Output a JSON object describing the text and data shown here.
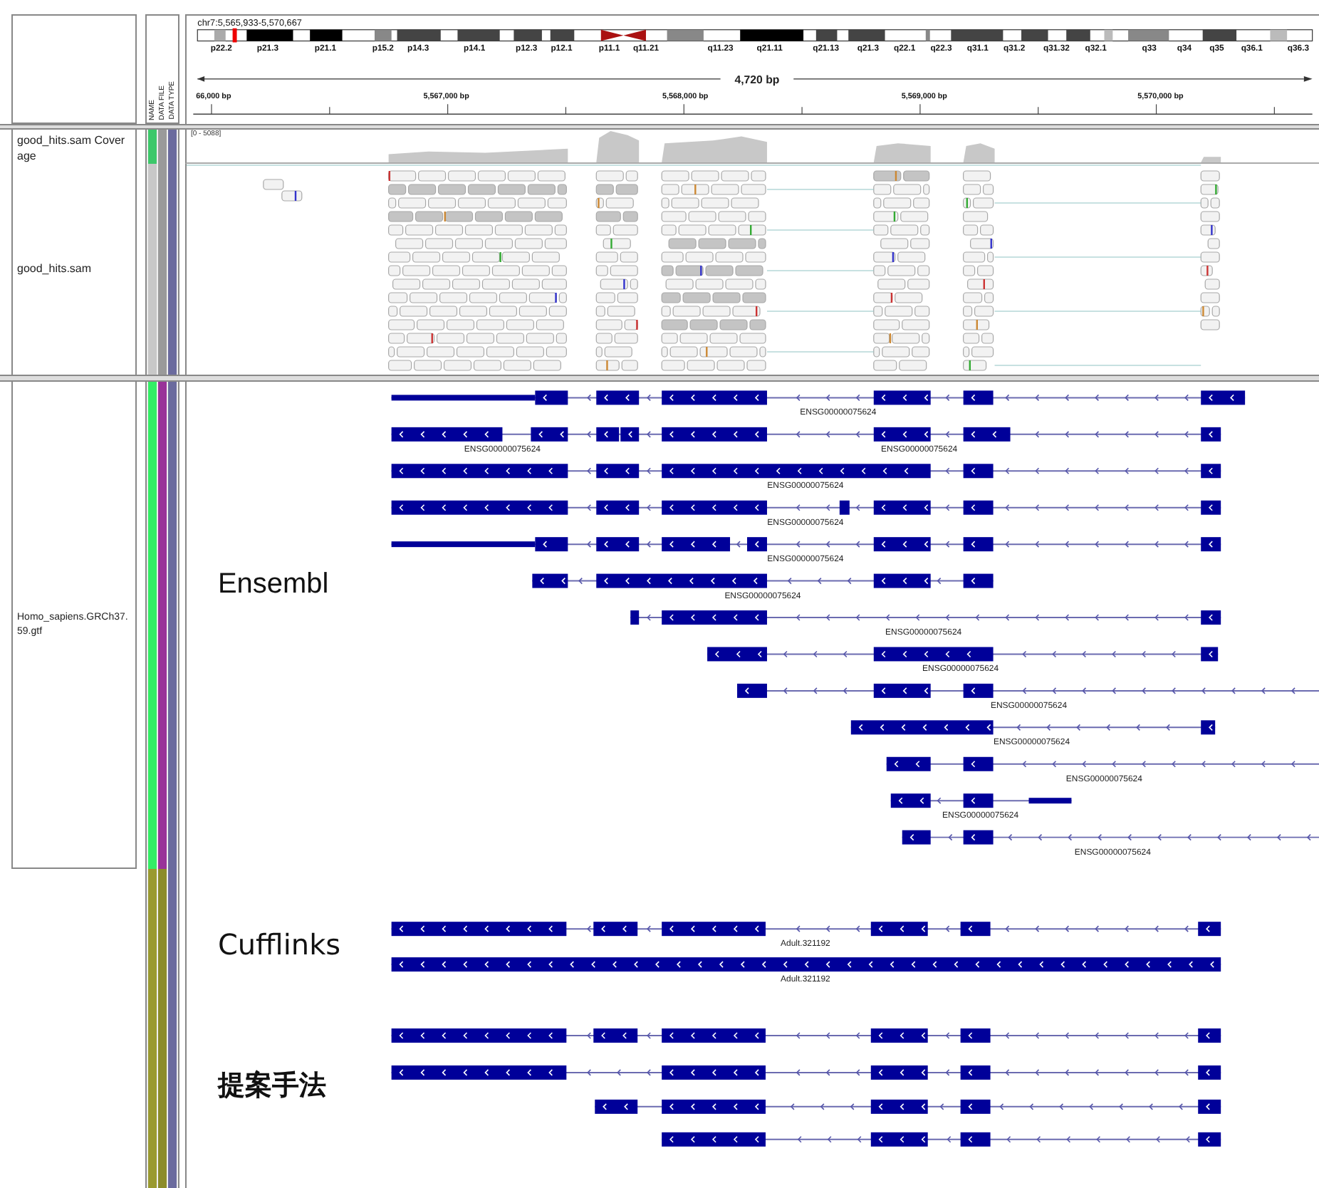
{
  "header": {
    "locus": "chr7:5,565,933-5,570,667",
    "bands": [
      "p22.2",
      "p21.3",
      "p21.1",
      "p15.2",
      "p14.3",
      "p14.1",
      "p12.3",
      "p12.1",
      "p11.1",
      "q11.21",
      "q11.23",
      "q21.11",
      "q21.13",
      "q21.3",
      "q22.1",
      "q22.3",
      "q31.1",
      "q31.2",
      "q31.32",
      "q32.1",
      "q33",
      "q34",
      "q35",
      "q36.1",
      "q36.3"
    ],
    "span": "4,720 bp",
    "ruler_labels": [
      "66,000 bp",
      "5,567,000 bp",
      "5,568,000 bp",
      "5,569,000 bp",
      "5,570,000 bp"
    ]
  },
  "attribute_headers": [
    "NAME",
    "DATA FILE",
    "DATA TYPE"
  ],
  "tracks": [
    {
      "kind": "coverage",
      "name": "good_hits.sam Coverage",
      "range": "[0 - 5088]",
      "attributes": [
        {
          "color": "#3cc86a"
        },
        {
          "color": "#9a9a9a"
        },
        {
          "color": "#6b6b9e"
        }
      ]
    },
    {
      "kind": "reads",
      "name": "good_hits.sam",
      "attributes": [
        {
          "color": "#c8c8c8"
        },
        {
          "color": "#9a9a9a"
        },
        {
          "color": "#6b6b9e"
        }
      ]
    },
    {
      "kind": "genes",
      "name": "Homo_sapiens.GRCh37.59.gtf",
      "annotation": "Ensembl",
      "attributes": [
        {
          "color": "#33ee66"
        },
        {
          "color": "#993399"
        },
        {
          "color": "#6b6b9e"
        }
      ],
      "transcripts": [
        {
          "labels": [
            "ENSG00000075624"
          ]
        },
        {
          "labels": [
            "ENSG00000075624",
            "ENSG00000075624"
          ]
        },
        {
          "labels": [
            "ENSG00000075624"
          ]
        },
        {
          "labels": [
            "ENSG00000075624"
          ]
        },
        {
          "labels": [
            "ENSG00000075624"
          ]
        },
        {
          "labels": [
            "ENSG00000075624"
          ]
        },
        {
          "labels": [
            "ENSG00000075624"
          ]
        },
        {
          "labels": [
            "ENSG00000075624"
          ]
        },
        {
          "labels": [
            "ENSG00000075624"
          ]
        },
        {
          "labels": [
            "ENSG00000075624"
          ]
        },
        {
          "labels": [
            "ENSG00000075624"
          ]
        },
        {
          "labels": [
            "ENSG00000075624"
          ]
        },
        {
          "labels": [
            "ENSG00000075624"
          ]
        }
      ]
    }
  ],
  "extra": {
    "attributes": [
      {
        "color": "#9a9a30"
      },
      {
        "color": "#8c8c2a"
      },
      {
        "color": "#6b6b9e"
      }
    ],
    "groups": [
      {
        "title": "Cufflinks",
        "transcripts": [
          {
            "labels": [
              "Adult.321192"
            ]
          },
          {
            "labels": [
              "Adult.321192"
            ]
          }
        ]
      },
      {
        "title": "提案手法",
        "transcripts": [
          {
            "kind": "transcript"
          },
          {
            "kind": "transcript"
          },
          {
            "kind": "transcript"
          },
          {
            "kind": "transcript"
          }
        ]
      }
    ]
  }
}
